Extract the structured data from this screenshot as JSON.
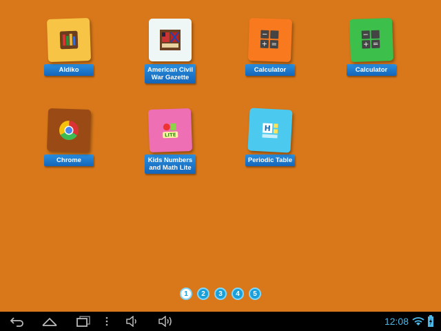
{
  "apps": [
    {
      "label": "Aldiko",
      "icon": "books-icon",
      "tile_color": "#f9c74f"
    },
    {
      "label": "American Civil War Gazette",
      "icon": "flags-icon",
      "tile_color": "#eef6f6"
    },
    {
      "label": "Calculator",
      "icon": "calculator-icon",
      "tile_color": "#f97316"
    },
    {
      "label": "Calculator",
      "icon": "calculator-icon",
      "tile_color": "#3fbf4a"
    },
    {
      "label": "Chrome",
      "icon": "chrome-icon",
      "tile_color": "#9a4a14"
    },
    {
      "label": "Kids Numbers and Math Lite",
      "icon": "math-lite-icon",
      "tile_color": "#ef6fb5"
    },
    {
      "label": "Periodic Table",
      "icon": "periodic-table-icon",
      "tile_color": "#4cc9ef"
    }
  ],
  "pager": {
    "pages": [
      "1",
      "2",
      "3",
      "4",
      "5"
    ],
    "active": "1"
  },
  "status": {
    "time": "12:08"
  },
  "colors": {
    "background": "#d9781a",
    "label": "#1e7bd0",
    "accent": "#4cb8e8"
  }
}
